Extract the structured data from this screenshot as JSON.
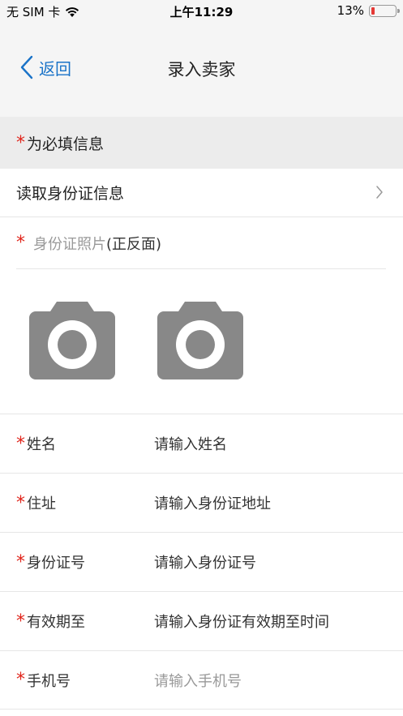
{
  "status_bar": {
    "carrier": "无 SIM 卡",
    "wifi_icon": "wifi-icon",
    "time": "上午11:29",
    "battery_percent": "13%",
    "battery_level": 0.13,
    "battery_color": "#e53935"
  },
  "nav": {
    "back_label": "返回",
    "title": "录入卖家",
    "accent_color": "#1a73c8"
  },
  "required_banner": {
    "star": "*",
    "text": "为必填信息"
  },
  "read_id": {
    "label": "读取身份证信息",
    "chevron_icon": "chevron-right-icon"
  },
  "id_photo": {
    "star": "*",
    "label": "身份证照片",
    "sub_label": "(正反面)",
    "camera_icon": "camera-icon"
  },
  "form": {
    "name": {
      "star": "*",
      "label": "姓名",
      "value": "请输入姓名"
    },
    "address": {
      "star": "*",
      "label": "住址",
      "value": "请输入身份证地址"
    },
    "id_number": {
      "star": "*",
      "label": "身份证号",
      "value": "请输入身份证号"
    },
    "valid_until": {
      "star": "*",
      "label": "有效期至",
      "value": "请输入身份证有效期至时间"
    },
    "phone": {
      "star": "*",
      "label": "手机号",
      "placeholder": "请输入手机号"
    }
  },
  "required_color": "#e0251b"
}
